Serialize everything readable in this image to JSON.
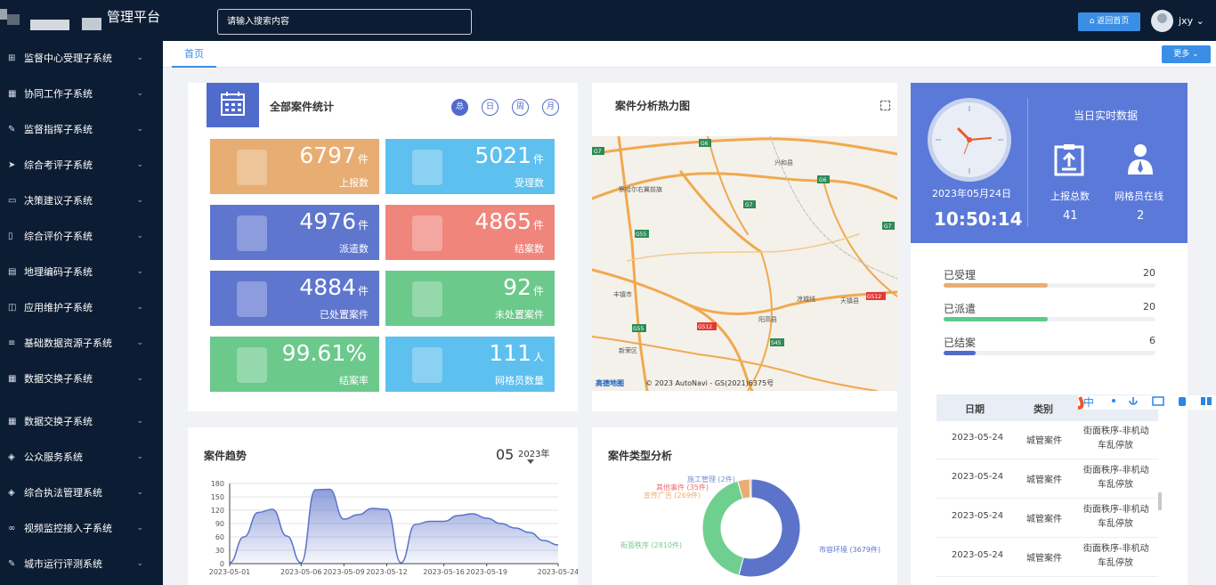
{
  "app": {
    "title": "管理平台",
    "search_placeholder": "请输入搜索内容",
    "home_button": "返回首页",
    "user": "jxy"
  },
  "sidebar": {
    "items": [
      {
        "label": "监督中心受理子系统",
        "icon": "grid-icon"
      },
      {
        "label": "协同工作子系统",
        "icon": "apps-icon"
      },
      {
        "label": "监督指挥子系统",
        "icon": "edit-icon"
      },
      {
        "label": "综合考评子系统",
        "icon": "send-icon"
      },
      {
        "label": "决策建议子系统",
        "icon": "comment-icon"
      },
      {
        "label": "综合评价子系统",
        "icon": "file-icon"
      },
      {
        "label": "地理编码子系统",
        "icon": "message-icon"
      },
      {
        "label": "应用维护子系统",
        "icon": "window-icon"
      },
      {
        "label": "基础数据资源子系统",
        "icon": "list-icon"
      },
      {
        "label": "数据交换子系统",
        "icon": "apps-icon"
      },
      {
        "label": "数据交换子系统",
        "icon": "apps-icon"
      },
      {
        "label": "公众服务系统",
        "icon": "tag-icon"
      },
      {
        "label": "综合执法管理系统",
        "icon": "tag-icon"
      },
      {
        "label": "视频监控接入子系统",
        "icon": "link-icon"
      },
      {
        "label": "城市运行评测系统",
        "icon": "edit-icon"
      }
    ]
  },
  "tabs": {
    "home": "首页",
    "more": "更多"
  },
  "stats": {
    "title": "全部案件统计",
    "filters": [
      "总",
      "日",
      "周",
      "月"
    ],
    "tiles": [
      {
        "value": "6797",
        "unit": "件",
        "label": "上报数",
        "color": "#e8ad72"
      },
      {
        "value": "5021",
        "unit": "件",
        "label": "受理数",
        "color": "#5ec0ef"
      },
      {
        "value": "4976",
        "unit": "件",
        "label": "派遣数",
        "color": "#5f76cf"
      },
      {
        "value": "4865",
        "unit": "件",
        "label": "结案数",
        "color": "#f0857c"
      },
      {
        "value": "4884",
        "unit": "件",
        "label": "已处置案件",
        "color": "#5f76cf"
      },
      {
        "value": "92",
        "unit": "件",
        "label": "未处置案件",
        "color": "#6bc98b"
      },
      {
        "value": "99.61%",
        "unit": "",
        "label": "结案率",
        "color": "#6bc98b"
      },
      {
        "value": "111",
        "unit": "人",
        "label": "网格员数量",
        "color": "#5ec0ef"
      }
    ]
  },
  "map": {
    "title": "案件分析热力图",
    "attribution": "© 2023 AutoNavi - GS(2021)6375号",
    "provider": "高德地图",
    "labels": [
      "G6",
      "兴和县",
      "G7",
      "察哈尔右翼前旗",
      "G6",
      "G7",
      "G55",
      "G7",
      "丰镇市",
      "凉城线",
      "天镇县",
      "G512",
      "G512",
      "阳高县",
      "G55",
      "S45",
      "新荣区"
    ]
  },
  "realtime": {
    "title": "当日实时数据",
    "date": "2023年05月24日",
    "time": "10:50:14",
    "report_label": "上报总数",
    "report_value": "41",
    "grid_label": "网格员在线",
    "grid_value": "2"
  },
  "progress": [
    {
      "label": "已受理",
      "value": 20,
      "fill": 0.49,
      "color": "#e8ad72"
    },
    {
      "label": "已派遣",
      "value": 20,
      "fill": 0.49,
      "color": "#5fc98a"
    },
    {
      "label": "已结案",
      "value": 6,
      "fill": 0.15,
      "color": "#4f6bcb"
    }
  ],
  "table": {
    "headers": [
      "日期",
      "类别"
    ],
    "rows": [
      {
        "date": "2023-05-24",
        "type": "城管案件",
        "desc1": "街面秩序-非机动",
        "desc2": "车乱停放"
      },
      {
        "date": "2023-05-24",
        "type": "城管案件",
        "desc1": "街面秩序-非机动",
        "desc2": "车乱停放"
      },
      {
        "date": "2023-05-24",
        "type": "城管案件",
        "desc1": "街面秩序-非机动",
        "desc2": "车乱停放"
      },
      {
        "date": "2023-05-24",
        "type": "城管案件",
        "desc1": "街面秩序-非机动",
        "desc2": "车乱停放"
      }
    ]
  },
  "trend": {
    "title": "案件趋势",
    "month": "05",
    "year": "2023年"
  },
  "chart_data": [
    {
      "type": "area",
      "title": "案件趋势",
      "x": [
        "2023-05-01",
        "2023-05-02",
        "2023-05-03",
        "2023-05-04",
        "2023-05-05",
        "2023-05-06",
        "2023-05-07",
        "2023-05-08",
        "2023-05-09",
        "2023-05-10",
        "2023-05-11",
        "2023-05-12",
        "2023-05-13",
        "2023-05-14",
        "2023-05-15",
        "2023-05-16",
        "2023-05-17",
        "2023-05-18",
        "2023-05-19",
        "2023-05-20",
        "2023-05-21",
        "2023-05-22",
        "2023-05-23",
        "2023-05-24"
      ],
      "xticks": [
        "2023-05-01",
        "2023-05-06",
        "2023-05-09",
        "2023-05-12",
        "2023-05-16",
        "2023-05-19",
        "2023-05-24"
      ],
      "values": [
        2,
        60,
        115,
        122,
        62,
        2,
        166,
        167,
        100,
        110,
        124,
        122,
        2,
        88,
        95,
        95,
        108,
        112,
        102,
        90,
        80,
        70,
        52,
        42
      ],
      "ylim": [
        0,
        180
      ],
      "yticks": [
        0,
        30,
        60,
        90,
        120,
        150,
        180
      ],
      "grid": true
    },
    {
      "type": "pie",
      "title": "案件类型分析",
      "labels": [
        "市容环境 (3679件)",
        "街面秩序 (2810件)",
        "宣传广告 (269件)",
        "其他事件 (35件)",
        "施工管理 (2件)"
      ],
      "values": [
        3679,
        2810,
        269,
        35,
        2
      ],
      "colors": [
        "#5b73c9",
        "#6fcf8f",
        "#e8ad72",
        "#ef6e6e",
        "#7b8dd6"
      ]
    }
  ]
}
